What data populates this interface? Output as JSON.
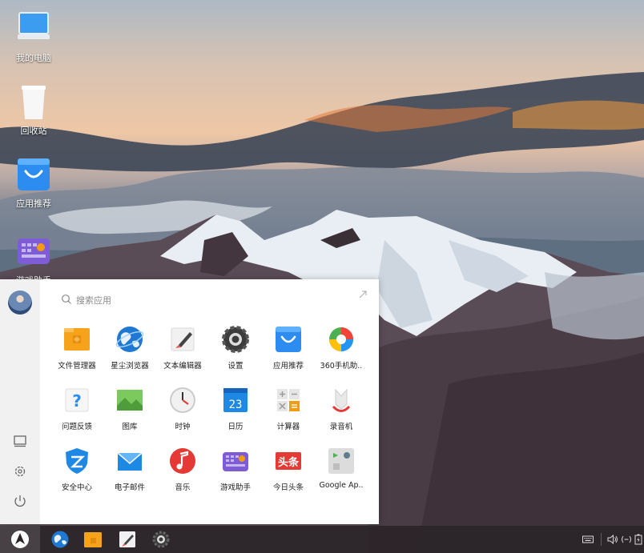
{
  "desktop": {
    "icons": [
      {
        "label": "我的电脑",
        "icon": "computer-icon"
      },
      {
        "label": "回收站",
        "icon": "trash-icon"
      },
      {
        "label": "应用推荐",
        "icon": "app-store-icon"
      },
      {
        "label": "游戏助手",
        "icon": "game-assistant-icon"
      }
    ]
  },
  "start_menu": {
    "search": {
      "placeholder": "搜索应用"
    },
    "sidebar": {
      "buttons": [
        {
          "name": "computer",
          "icon": "monitor-icon"
        },
        {
          "name": "settings",
          "icon": "gear-icon"
        },
        {
          "name": "power",
          "icon": "power-icon"
        }
      ]
    },
    "apps": [
      {
        "label": "文件管理器",
        "icon": "folder-icon"
      },
      {
        "label": "星尘浏览器",
        "icon": "browser-globe-icon"
      },
      {
        "label": "文本编辑器",
        "icon": "text-editor-icon"
      },
      {
        "label": "设置",
        "icon": "settings-gear-icon"
      },
      {
        "label": "应用推荐",
        "icon": "app-store-icon"
      },
      {
        "label": "360手机助..",
        "icon": "360-assistant-icon"
      },
      {
        "label": "问题反馈",
        "icon": "feedback-icon"
      },
      {
        "label": "图库",
        "icon": "gallery-icon"
      },
      {
        "label": "时钟",
        "icon": "clock-icon"
      },
      {
        "label": "日历",
        "icon": "calendar-icon"
      },
      {
        "label": "计算器",
        "icon": "calculator-icon"
      },
      {
        "label": "录音机",
        "icon": "recorder-icon"
      },
      {
        "label": "安全中心",
        "icon": "security-shield-icon"
      },
      {
        "label": "电子邮件",
        "icon": "mail-icon"
      },
      {
        "label": "音乐",
        "icon": "music-icon"
      },
      {
        "label": "游戏助手",
        "icon": "game-assistant-icon"
      },
      {
        "label": "今日头条",
        "icon": "toutiao-icon"
      },
      {
        "label": "Google Ap..",
        "icon": "google-apps-icon"
      }
    ],
    "calendar_day": "23",
    "toutiao_text": "头条"
  },
  "taskbar": {
    "pinned": [
      "browser-globe-icon",
      "folder-icon",
      "text-editor-icon",
      "settings-gear-icon"
    ],
    "tray": [
      "keyboard-icon",
      "volume-icon",
      "network-icon",
      "battery-icon"
    ]
  },
  "colors": {
    "taskbar": "#2a2428",
    "menu_bg": "#ffffff",
    "sidebar_bg": "#f1f1f1",
    "accent_blue": "#2d8cf0",
    "folder_orange": "#f7a21b"
  }
}
